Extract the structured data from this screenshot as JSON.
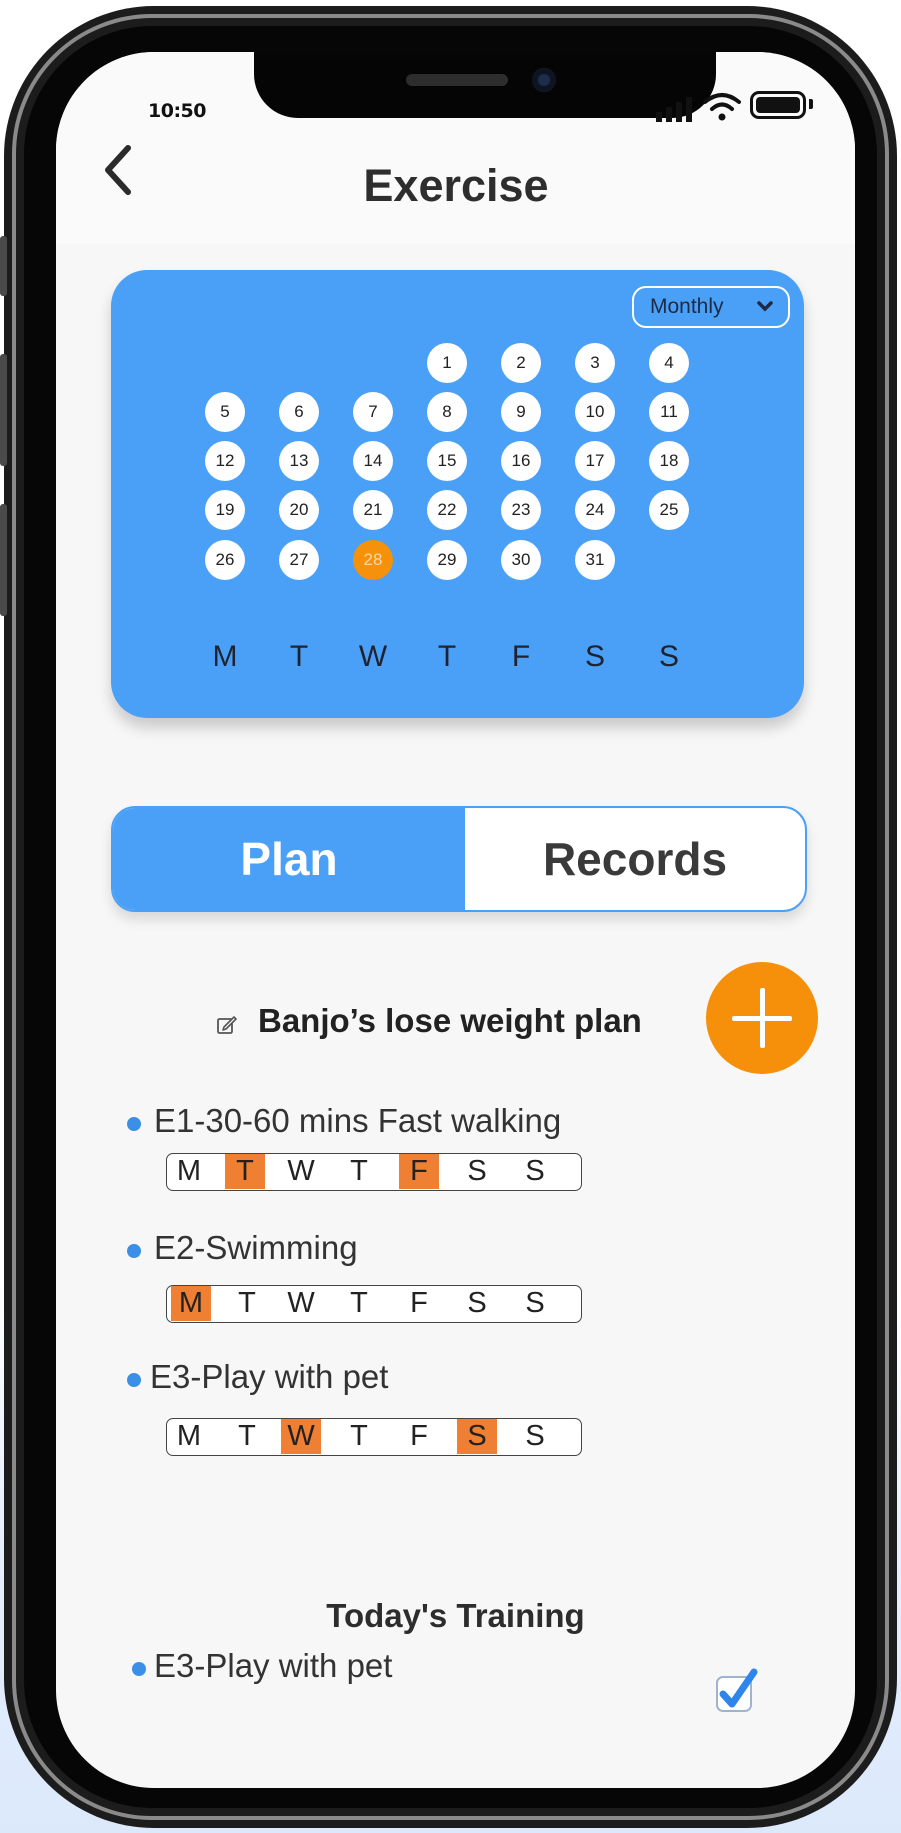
{
  "status_bar": {
    "time": "10:50"
  },
  "header": {
    "title": "Exercise",
    "back_icon": "chevron-left-icon"
  },
  "calendar": {
    "view_select": "Monthly",
    "days": [
      "1",
      "2",
      "3",
      "4",
      "5",
      "6",
      "7",
      "8",
      "9",
      "10",
      "11",
      "12",
      "13",
      "14",
      "15",
      "16",
      "17",
      "18",
      "19",
      "20",
      "21",
      "22",
      "23",
      "24",
      "25",
      "26",
      "27",
      "28",
      "29",
      "30",
      "31"
    ],
    "selected_day": "28",
    "weekdays": [
      "M",
      "T",
      "W",
      "T",
      "F",
      "S",
      "S"
    ],
    "selected_color": "#f5910a",
    "accent": "#4aa0f7"
  },
  "tabs": {
    "plan": "Plan",
    "records": "Records",
    "active": "plan"
  },
  "plan": {
    "title": "Banjo’s lose weight plan",
    "exercises": [
      {
        "label": "E1-30-60 mins Fast walking",
        "days": [
          "M",
          "T",
          "W",
          "T",
          "F",
          "S",
          "S"
        ],
        "active": [
          false,
          true,
          false,
          false,
          true,
          false,
          false
        ]
      },
      {
        "label": "E2-Swimming",
        "days": [
          "M",
          "T",
          "W",
          "T",
          "F",
          "S",
          "S"
        ],
        "active": [
          true,
          false,
          false,
          false,
          false,
          false,
          false
        ]
      },
      {
        "label": "E3-Play with pet",
        "days": [
          "M",
          "T",
          "W",
          "T",
          "F",
          "S",
          "S"
        ],
        "active": [
          false,
          false,
          true,
          false,
          false,
          true,
          false
        ]
      }
    ],
    "highlight_color": "#ef7f32"
  },
  "today": {
    "title": "Today's Training",
    "items": [
      {
        "label": "E3-Play with pet",
        "checked": true
      }
    ]
  }
}
